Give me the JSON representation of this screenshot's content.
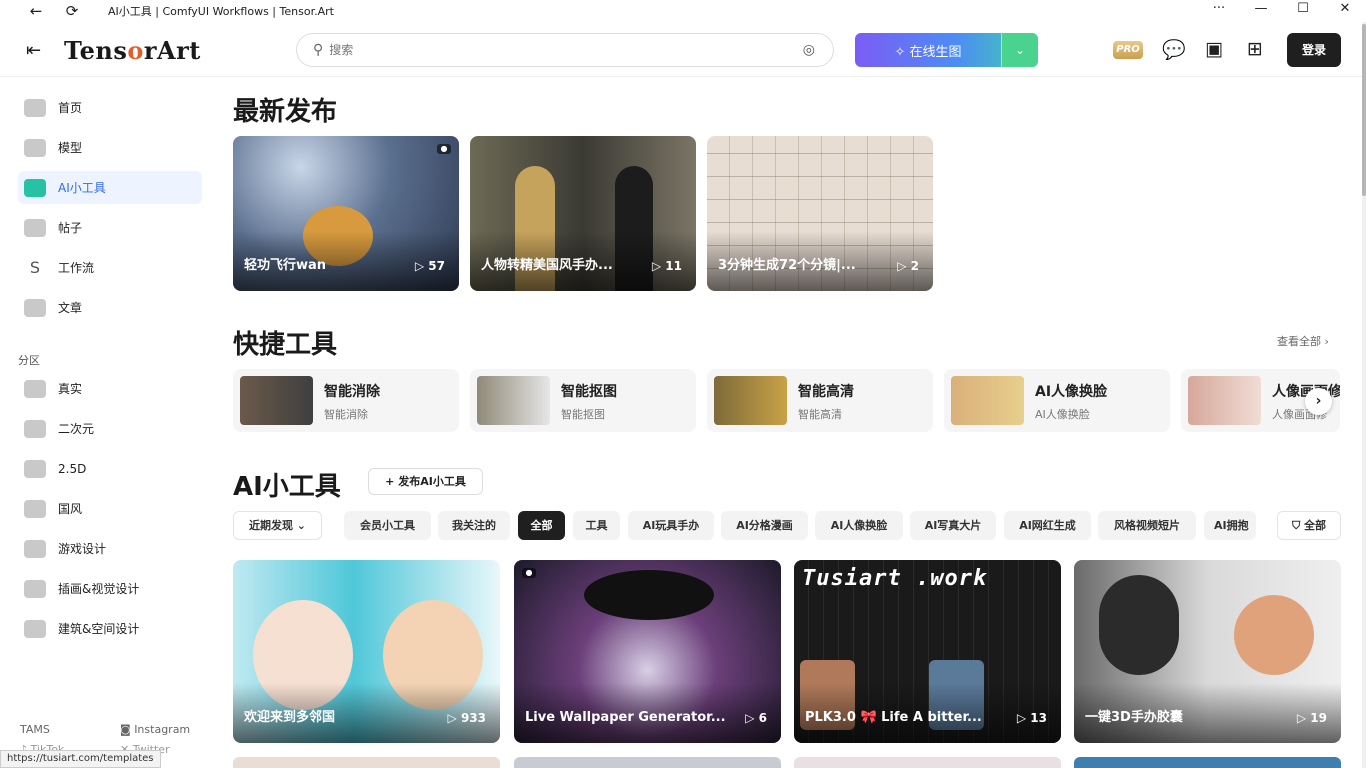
{
  "window": {
    "title": "AI小工具 | ComfyUI Workflows | Tensor.Art",
    "back_icon": "←",
    "reload_icon": "⟳",
    "more_icon": "···",
    "min_icon": "—",
    "max_icon": "☐",
    "close_icon": "✕"
  },
  "header": {
    "menu_icon": "⇤",
    "logo_pre": "Tens",
    "logo_o": "o",
    "logo_post": "rArt",
    "search_placeholder": "搜索",
    "search_icon": "⚲",
    "camera_icon": "◎",
    "generate_label": "在线生图",
    "generate_icon": "✧",
    "dropdown_icon": "⌄",
    "pro_label": "PRO",
    "chat_icon": "💬",
    "calendar_icon": "▣",
    "apps_icon": "⊞",
    "login_label": "登录"
  },
  "sidebar": {
    "items": [
      {
        "label": "首页"
      },
      {
        "label": "模型"
      },
      {
        "label": "AI小工具"
      },
      {
        "label": "帖子"
      },
      {
        "label": "工作流"
      },
      {
        "label": "文章"
      }
    ],
    "section_label": "分区",
    "zones": [
      {
        "label": "真实"
      },
      {
        "label": "二次元"
      },
      {
        "label": "2.5D"
      },
      {
        "label": "国风"
      },
      {
        "label": "游戏设计"
      },
      {
        "label": "插画&视觉设计"
      },
      {
        "label": "建筑&空间设计"
      }
    ],
    "footer": {
      "tams": "TAMS",
      "instagram": "Instagram",
      "tiktok": "TikTok",
      "twitter": "Twitter"
    }
  },
  "latest": {
    "heading": "最新发布",
    "cards": [
      {
        "title": "轻功飞行wan",
        "count": "▷ 57"
      },
      {
        "title": "人物转精美国风手办...",
        "count": "▷ 11"
      },
      {
        "title": "3分钟生成72个分镜|...",
        "count": "▷ 2"
      }
    ]
  },
  "quick": {
    "heading": "快捷工具",
    "view_all": "查看全部 ›",
    "tools": [
      {
        "name": "智能消除",
        "sub": "智能消除"
      },
      {
        "name": "智能抠图",
        "sub": "智能抠图"
      },
      {
        "name": "智能高清",
        "sub": "智能高清"
      },
      {
        "name": "AI人像换脸",
        "sub": "AI人像换脸"
      },
      {
        "name": "人像画面修",
        "sub": "人像画面修"
      }
    ],
    "next_icon": "›"
  },
  "ai_tools": {
    "heading": "AI小工具",
    "publish_label": "+ 发布AI小工具",
    "sort_label": "近期发现 ⌄",
    "filters": [
      "会员小工具",
      "我关注的",
      "全部",
      "工具",
      "AI玩具手办",
      "AI分格漫画",
      "AI人像换脸",
      "AI写真大片",
      "AI网红生成",
      "风格视频短片",
      "AI拥抱"
    ],
    "active_filter": "全部",
    "all_filter_label": "⛉ 全部",
    "cards": [
      {
        "title": "欢迎来到多邻国",
        "count": "▷ 933"
      },
      {
        "title": "Live Wallpaper Generator...",
        "count": "▷ 6"
      },
      {
        "title": "PLK3.0 🎀 Life A bitter...",
        "count": "▷ 13"
      },
      {
        "title": "一键3D手办胶囊",
        "count": "▷ 19"
      }
    ],
    "tusi_text": "Tusiart .work"
  },
  "status_bar": "https://tusiart.com/templates"
}
